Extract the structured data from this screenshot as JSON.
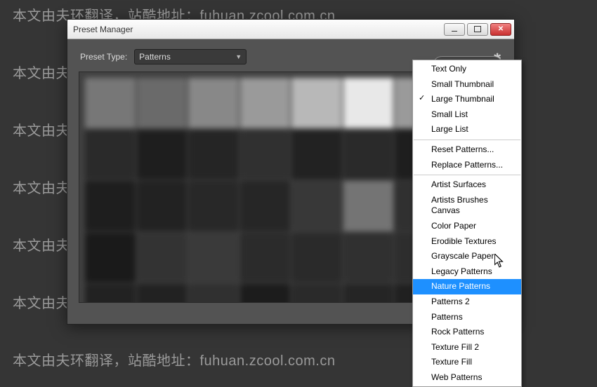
{
  "watermark_text": "本文由夫环翻译，站酷地址：fuhuan.zcool.com.cn",
  "watermark_rows": [
    6,
    88,
    170,
    252,
    334,
    416,
    498
  ],
  "window": {
    "title": "Preset Manager"
  },
  "toolbar": {
    "preset_type_label": "Preset Type:",
    "preset_type_value": "Patterns"
  },
  "menu": {
    "sections": [
      {
        "items": [
          {
            "label": "Text Only"
          },
          {
            "label": "Small Thumbnail"
          },
          {
            "label": "Large Thumbnail",
            "checked": true
          },
          {
            "label": "Small List"
          },
          {
            "label": "Large List"
          }
        ]
      },
      {
        "items": [
          {
            "label": "Reset Patterns..."
          },
          {
            "label": "Replace Patterns..."
          }
        ]
      },
      {
        "items": [
          {
            "label": "Artist Surfaces"
          },
          {
            "label": "Artists Brushes Canvas"
          },
          {
            "label": "Color Paper"
          },
          {
            "label": "Erodible Textures"
          },
          {
            "label": "Grayscale Paper"
          },
          {
            "label": "Legacy Patterns"
          },
          {
            "label": "Nature Patterns",
            "hover": true
          },
          {
            "label": "Patterns 2"
          },
          {
            "label": "Patterns"
          },
          {
            "label": "Rock Patterns"
          },
          {
            "label": "Texture Fill 2"
          },
          {
            "label": "Texture Fill"
          },
          {
            "label": "Web Patterns"
          }
        ]
      }
    ]
  },
  "grid_cells": [
    "#777",
    "#6a6a6a",
    "#888",
    "#9a9a9a",
    "#b8b8b8",
    "#e8e8e8",
    "#9a9a9a",
    "#333",
    "#2a2a2a",
    "#1e1e1e",
    "#252525",
    "#303030",
    "#222",
    "#2a2a2a",
    "#1e1e1e",
    "#1a1a1a",
    "#1e1e1e",
    "#222",
    "#282828",
    "#262626",
    "#383838",
    "#747474",
    "#303030",
    "#a0a0a0",
    "#1a1a1a",
    "#333",
    "#3a3a3a",
    "#2b2b2b",
    "#2a2a2a",
    "#303030",
    "#2d2d2d",
    "#2e2e2e",
    "#222",
    "#222",
    "#303030",
    "#1c1c1c",
    "#2a2a2a",
    "#252525",
    "#202020",
    "#1e1e1e"
  ]
}
